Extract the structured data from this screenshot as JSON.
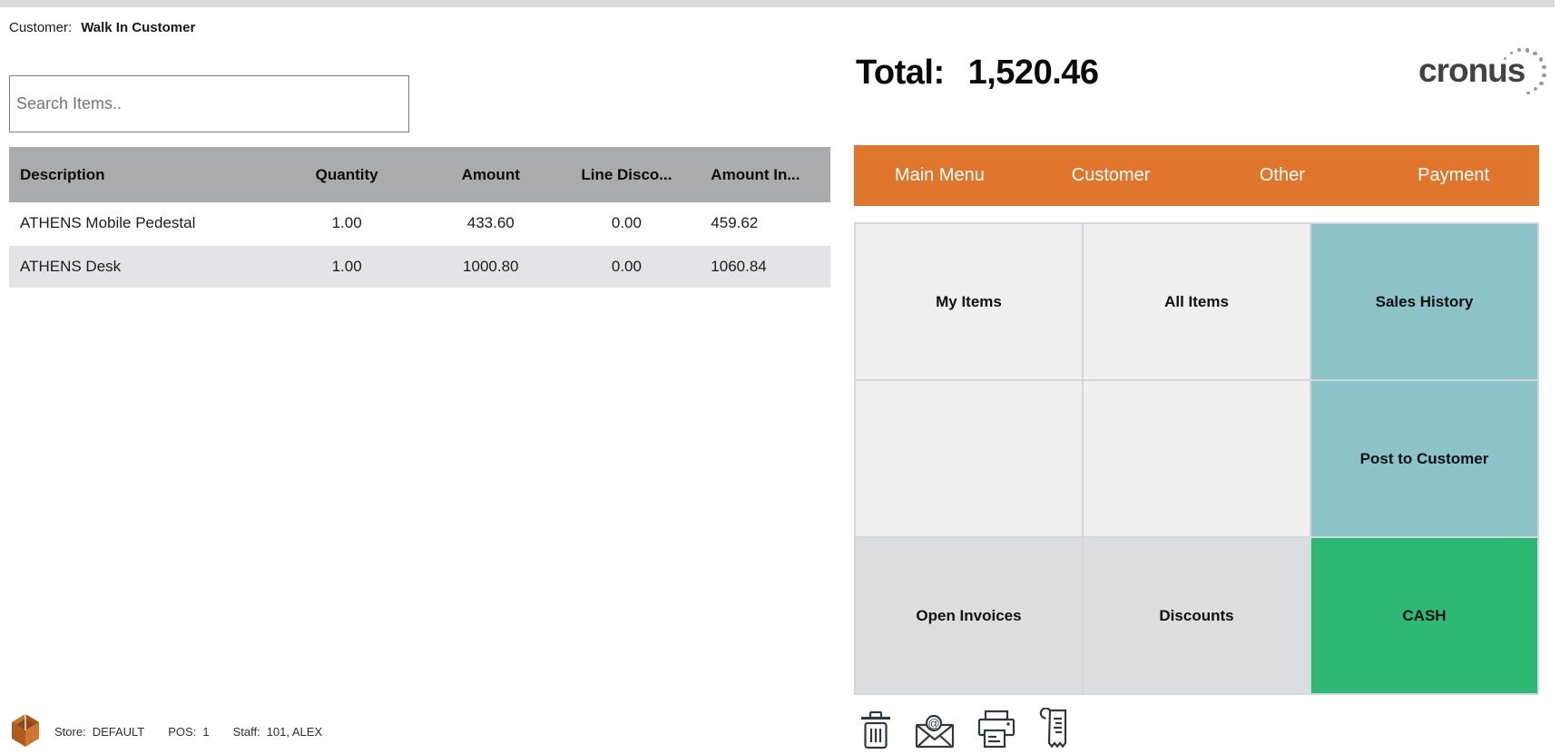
{
  "customer": {
    "label": "Customer:",
    "name": "Walk In Customer"
  },
  "search": {
    "placeholder": "Search Items.."
  },
  "cart_table": {
    "columns": [
      "Description",
      "Quantity",
      "Amount",
      "Line Disco...",
      "Amount In..."
    ],
    "rows": [
      {
        "description": "ATHENS Mobile Pedestal",
        "quantity": "1.00",
        "amount": "433.60",
        "line_discount": "0.00",
        "amount_incl": "459.62"
      },
      {
        "description": "ATHENS Desk",
        "quantity": "1.00",
        "amount": "1000.80",
        "line_discount": "0.00",
        "amount_incl": "1060.84"
      }
    ]
  },
  "total": {
    "label": "Total:",
    "value": "1,520.46"
  },
  "brand": {
    "name": "cronus"
  },
  "menu": {
    "items": [
      "Main Menu",
      "Customer",
      "Other",
      "Payment"
    ]
  },
  "tiles": [
    {
      "label": "My Items",
      "type": "light"
    },
    {
      "label": "All Items",
      "type": "light"
    },
    {
      "label": "Sales History",
      "type": "teal"
    },
    {
      "label": "",
      "type": "light"
    },
    {
      "label": "",
      "type": "light"
    },
    {
      "label": "Post to Customer",
      "type": "teal"
    },
    {
      "label": "Open Invoices",
      "type": "muted"
    },
    {
      "label": "Discounts",
      "type": "muted"
    },
    {
      "label": "CASH",
      "type": "green"
    }
  ],
  "footer": {
    "icons": [
      "trash-icon",
      "email-icon",
      "printer-icon",
      "receipt-icon"
    ],
    "status": {
      "store_label": "Store:",
      "store_value": "DEFAULT",
      "pos_label": "POS:",
      "pos_value": "1",
      "staff_label": "Staff:",
      "staff_value": "101, ALEX"
    }
  },
  "colors": {
    "accent_orange": "#e0762b",
    "tile_teal": "#8cc3c8",
    "tile_green": "#2db873",
    "tile_light": "#efefef",
    "tile_muted": "#dcdde0",
    "table_header": "#a9abad",
    "row_alt": "#e4e4e6",
    "icon_dark": "#2c3a43"
  }
}
